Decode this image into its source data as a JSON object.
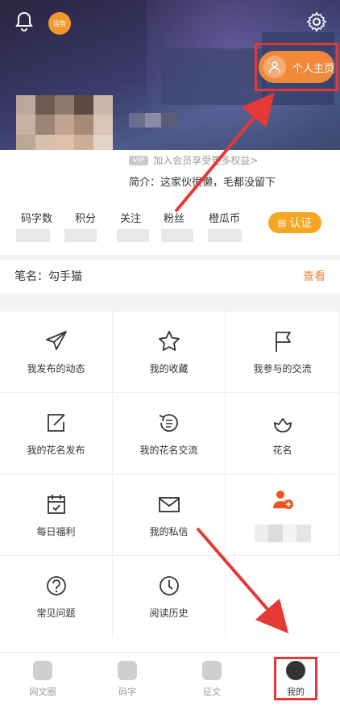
{
  "header": {
    "vip_badge": "运势",
    "homepage_button": "个人主页"
  },
  "profile": {
    "vip_tag": "VIP",
    "vip_text": "加入会员享受更多权益>",
    "bio": "简介：这家伙很懒，毛都没留下"
  },
  "stats": {
    "items": [
      {
        "label": "码字数"
      },
      {
        "label": "积分"
      },
      {
        "label": "关注"
      },
      {
        "label": "粉丝"
      },
      {
        "label": "橙瓜币"
      }
    ],
    "cert_button": "认证"
  },
  "penname": {
    "label": "笔名：勾手猫",
    "view": "查看"
  },
  "grid": [
    {
      "label": "我发布的动态",
      "icon": "paper-plane-icon"
    },
    {
      "label": "我的收藏",
      "icon": "star-icon"
    },
    {
      "label": "我参与的交流",
      "icon": "flag-icon"
    },
    {
      "label": "我的花名发布",
      "icon": "edit-icon"
    },
    {
      "label": "我的花名交流",
      "icon": "exchange-icon"
    },
    {
      "label": "花名",
      "icon": "flower-icon"
    },
    {
      "label": "每日福利",
      "icon": "calendar-icon"
    },
    {
      "label": "我的私信",
      "icon": "mail-icon"
    },
    {
      "label": "",
      "icon": "add-friend-icon"
    },
    {
      "label": "常见问题",
      "icon": "help-icon"
    },
    {
      "label": "阅读历史",
      "icon": "clock-icon"
    }
  ],
  "nav": {
    "items": [
      {
        "label": "网文圈"
      },
      {
        "label": "码字"
      },
      {
        "label": "征文"
      },
      {
        "label": "我的"
      }
    ]
  },
  "colors": {
    "accent": "#f08a3a",
    "highlight_red": "#e53935",
    "cert": "#f5a623"
  }
}
